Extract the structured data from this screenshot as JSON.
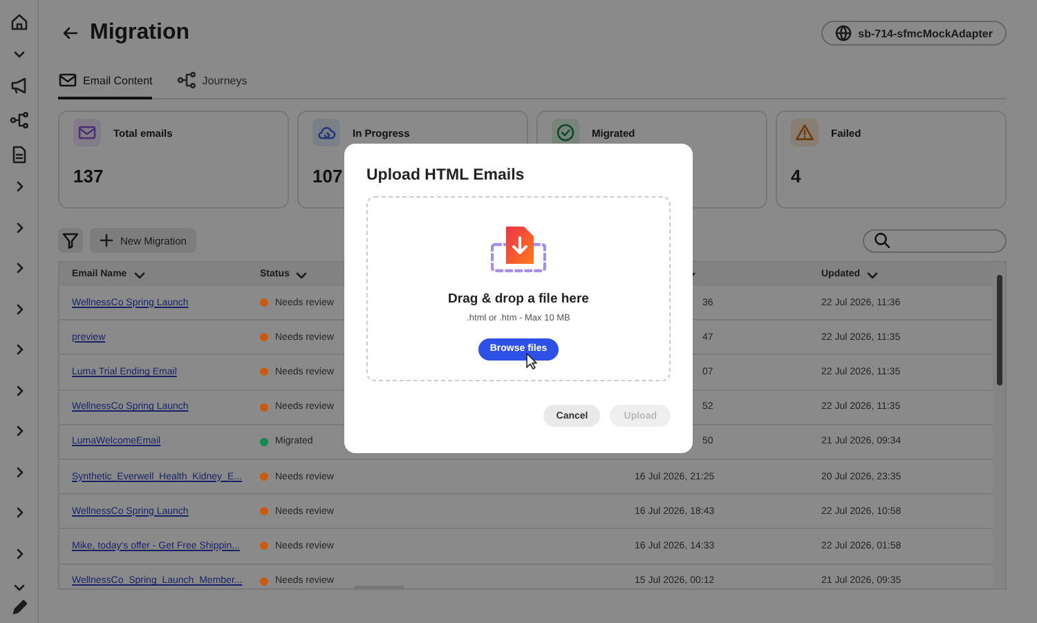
{
  "header": {
    "title": "Migration",
    "sandbox": "sb-714-sfmcMockAdapter"
  },
  "tabs": [
    {
      "label": "Email Content",
      "selected": true
    },
    {
      "label": "Journeys",
      "selected": false
    }
  ],
  "cards": [
    {
      "label": "Total emails",
      "value": "137"
    },
    {
      "label": "In Progress",
      "value": "107"
    },
    {
      "label": "Migrated"
    },
    {
      "label": "Failed",
      "value": "4"
    }
  ],
  "toolbar": {
    "new_button": "New Migration"
  },
  "table": {
    "columns": [
      "Email Name",
      "Status",
      "",
      "Updated"
    ],
    "rows": [
      {
        "name": "WellnessCo Spring Launch",
        "status": "Needs review",
        "color": "#c95a12",
        "column_3": "36",
        "updated": "22 Jul 2026, 11:36"
      },
      {
        "name": "preview",
        "status": "Needs review",
        "color": "#c95a12",
        "column_3": "47",
        "updated": "22 Jul 2026, 11:35"
      },
      {
        "name": "Luma Trial Ending Email",
        "status": "Needs review",
        "color": "#c95a12",
        "column_3": "07",
        "updated": "22 Jul 2026, 11:35"
      },
      {
        "name": "WellnessCo Spring Launch",
        "status": "Needs review",
        "color": "#c95a12",
        "column_3": "52",
        "updated": "22 Jul 2026, 11:35"
      },
      {
        "name": "LumaWelcomeEmail",
        "status": "Migrated",
        "color": "#148a4e",
        "column_3": "50",
        "updated": "21 Jul 2026, 09:34"
      },
      {
        "name": "Synthetic_Everwell_Health_Kidney_E...",
        "status": "Needs review",
        "color": "#c95a12",
        "column_3": "16 Jul 2026, 21:25",
        "updated": "20 Jul 2026, 23:35"
      },
      {
        "name": "WellnessCo Spring Launch",
        "status": "Needs review",
        "color": "#c95a12",
        "column_3": "16 Jul 2026, 18:43",
        "updated": "22 Jul 2026, 10:58"
      },
      {
        "name": "Mike, today's offer -   Get Free Shippin...",
        "status": "Needs review",
        "color": "#c95a12",
        "column_3": "16 Jul 2026, 14:33",
        "updated": "22 Jul 2026, 01:58"
      },
      {
        "name": "WellnessCo_Spring_Launch_Member...",
        "status": "Needs review",
        "color": "#c95a12",
        "column_3": "15 Jul 2026, 00:12",
        "updated": "21 Jul 2026, 09:35"
      }
    ]
  },
  "dialog": {
    "title": "Upload HTML Emails",
    "drop_text": "Drag & drop a file here",
    "hint": ".html or .htm - Max 10 MB",
    "browse": "Browse files",
    "buttons": [
      {
        "label": "Cancel",
        "disabled": false
      },
      {
        "label": "Upload",
        "disabled": true
      }
    ]
  }
}
